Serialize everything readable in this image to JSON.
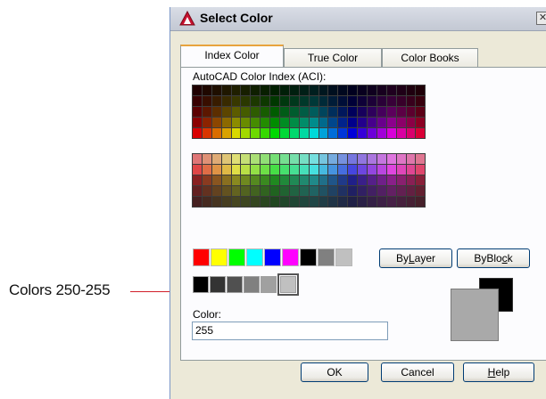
{
  "callout": {
    "label": "Colors 250-255",
    "color": "#d11f2a"
  },
  "window": {
    "title": "Select Color",
    "close_glyph": "✕",
    "app_icon": "autocad-triangle-icon"
  },
  "tabs": [
    {
      "label": "Index Color",
      "active": true
    },
    {
      "label": "True Color",
      "active": false
    },
    {
      "label": "Color Books",
      "active": false
    }
  ],
  "aci_label": "AutoCAD Color Index (ACI):",
  "palette": {
    "hues": [
      "#ff0000",
      "#ff4000",
      "#ff8000",
      "#ffbf00",
      "#ffff00",
      "#bfff00",
      "#80ff00",
      "#40ff00",
      "#00ff00",
      "#00ff40",
      "#00ff80",
      "#00ffbf",
      "#00ffff",
      "#00bfff",
      "#0080ff",
      "#0040ff",
      "#0000ff",
      "#4000ff",
      "#8000ff",
      "#bf00ff",
      "#ff00ff",
      "#ff00bf",
      "#ff0080",
      "#ff0040"
    ]
  },
  "standard_colors": [
    "#ff0000",
    "#ffff00",
    "#00ff00",
    "#00ffff",
    "#0000ff",
    "#ff00ff",
    "#000000",
    "#808080",
    "#c0c0c0"
  ],
  "gray_colors": [
    "#000000",
    "#333333",
    "#505050",
    "#808080",
    "#a0a0a0",
    "#c0c0c0"
  ],
  "selected_gray_index": 5,
  "buttons": {
    "bylayer": {
      "pre": "By",
      "u": "L",
      "post": "ayer"
    },
    "byblock": {
      "pre": "ByBlo",
      "u": "c",
      "post": "k"
    },
    "ok": "OK",
    "cancel": "Cancel",
    "help": {
      "pre": "",
      "u": "H",
      "post": "elp"
    }
  },
  "color_field": {
    "label": "Color:",
    "value": "255"
  },
  "preview": {
    "new_color": "#000000",
    "old_color": "#a9a9a9"
  }
}
